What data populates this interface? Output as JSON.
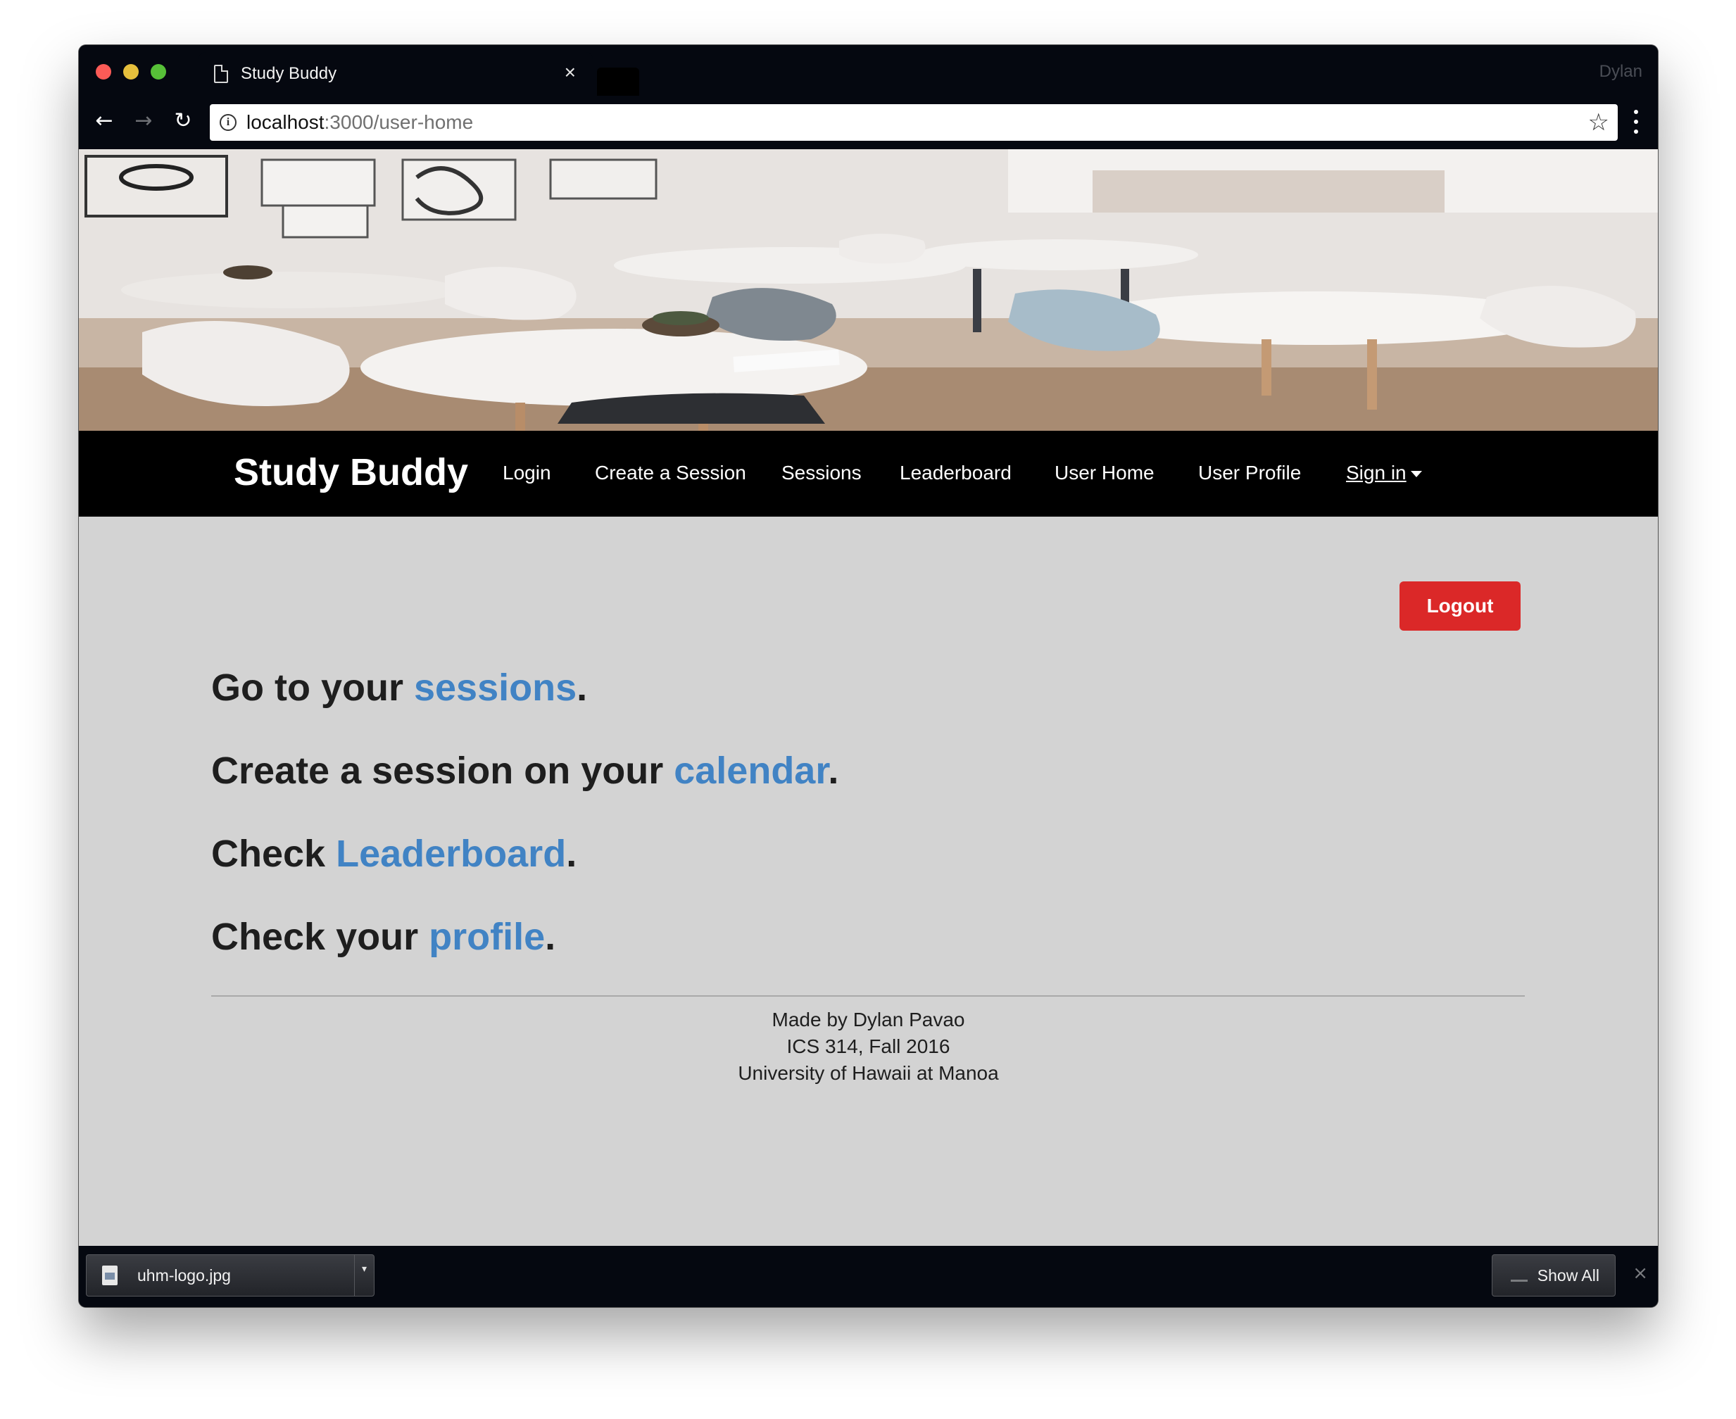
{
  "browser": {
    "tab_title": "Study Buddy",
    "tab_close": "×",
    "profile_name": "Dylan",
    "url_host": "localhost",
    "url_path": ":3000/user-home",
    "back_glyph": "←",
    "forward_glyph": "→",
    "reload_glyph": "↻",
    "star_glyph": "☆",
    "icons": [
      "close-icon",
      "back-arrow-icon",
      "forward-arrow-icon",
      "reload-icon",
      "info-icon",
      "bookmark-star-icon",
      "menu-icon",
      "document-icon"
    ]
  },
  "navbar": {
    "brand": "Study Buddy",
    "links": {
      "login": "Login",
      "create_session": "Create a Session",
      "sessions": "Sessions",
      "leaderboard": "Leaderboard",
      "user_home": "User Home",
      "user_profile": "User Profile",
      "sign_in": "Sign in"
    }
  },
  "main": {
    "logout_label": "Logout",
    "ctas": [
      {
        "prefix": "Go to your ",
        "link": "sessions",
        "suffix": "."
      },
      {
        "prefix": "Create a session on your ",
        "link": "calendar",
        "suffix": "."
      },
      {
        "prefix": "Check ",
        "link": "Leaderboard",
        "suffix": "."
      },
      {
        "prefix": "Check your ",
        "link": "profile",
        "suffix": "."
      }
    ]
  },
  "footer": {
    "line1": "Made by Dylan Pavao",
    "line2": "ICS 314, Fall 2016",
    "line3": "University of Hawaii at Manoa"
  },
  "download_shelf": {
    "file_name": "uhm-logo.jpg",
    "caret": "▾",
    "show_all": "Show All",
    "close": "×"
  },
  "colors": {
    "link": "#4183c4",
    "logout": "#db2828",
    "page_bg": "#d3d3d3",
    "navbar_bg": "#000000"
  }
}
